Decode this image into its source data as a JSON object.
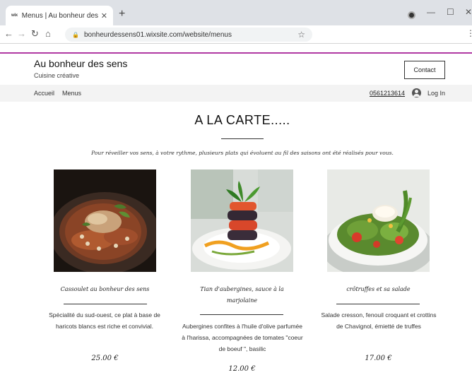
{
  "browser": {
    "tab_title": "Menus | Au bonheur des sens",
    "favicon": "wix",
    "url": "bonheurdessens01.wixsite.com/website/menus"
  },
  "site": {
    "title": "Au bonheur des sens",
    "subtitle": "Cuisine créative",
    "contact_label": "Contact",
    "nav": [
      "Accueil",
      "Menus"
    ],
    "phone": "0561213614",
    "login_label": "Log In"
  },
  "menu": {
    "heading": "A LA CARTE.....",
    "intro": "Pour réveiller vos sens, à votre rythme, plusieurs plats qui évoluent au fil des saisons ont été réalisés pour vous.",
    "dishes": [
      {
        "name": "Cassoulet au bonheur des sens",
        "description": "Spécialité du sud-ouest, ce plat à base de haricots blancs est riche et convivial.",
        "price": "25.00 €"
      },
      {
        "name": "Tian d'aubergines, sauce à la marjolaine",
        "description": "Aubergines confites à l'huile d'olive parfumée à l'harissa, accompagnées de tomates \"coeur de boeuf \", basilic",
        "price": "12.00 €"
      },
      {
        "name": "crôtruffes et sa salade",
        "description": "Salade cresson, fenouil croquant et crottins de Chavignol, émietté de truffes",
        "price": "17.00 €"
      }
    ]
  },
  "colors": {
    "accent": "#b03aa3",
    "nav_bg": "#f3f3f3"
  },
  "icons": [
    "back-arrow-icon",
    "forward-arrow-icon",
    "reload-icon",
    "home-icon",
    "lock-icon",
    "star-icon",
    "user-icon",
    "kebab-menu-icon"
  ]
}
